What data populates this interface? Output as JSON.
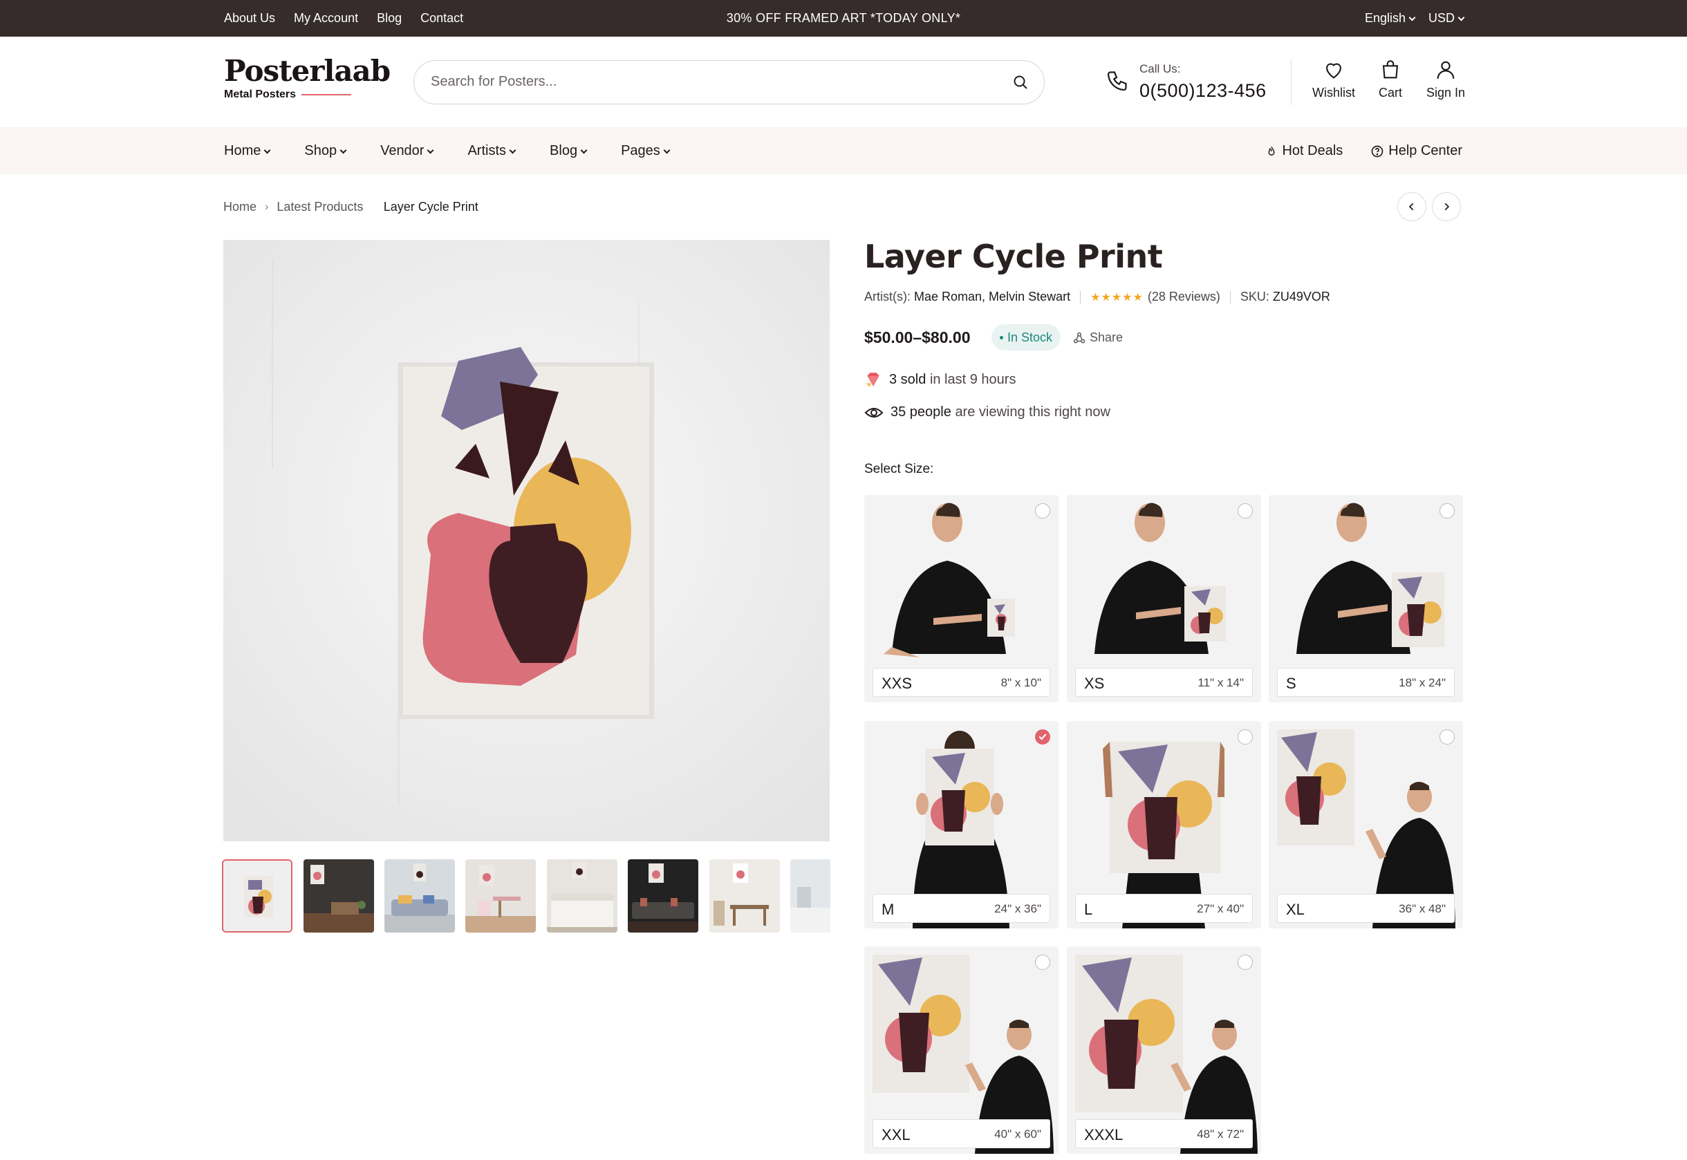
{
  "topbar": {
    "links": [
      "About Us",
      "My Account",
      "Blog",
      "Contact"
    ],
    "promo": "30% OFF FRAMED ART *TODAY ONLY*",
    "language": "English",
    "currency": "USD"
  },
  "header": {
    "logo_name": "Posterlaab",
    "logo_sub": "Metal Posters",
    "search_placeholder": "Search for Posters...",
    "call_label": "Call Us:",
    "phone": "0(500)123-456",
    "wishlist": "Wishlist",
    "cart": "Cart",
    "signin": "Sign In"
  },
  "nav": {
    "items": [
      "Home",
      "Shop",
      "Vendor",
      "Artists",
      "Blog",
      "Pages"
    ],
    "hot_deals": "Hot Deals",
    "help_center": "Help Center"
  },
  "breadcrumb": [
    "Home",
    "Latest Products",
    "Layer Cycle Print"
  ],
  "product": {
    "title": "Layer Cycle Print",
    "artists_label": "Artist(s):",
    "artists": "Mae Roman, Melvin Stewart",
    "rating": 5,
    "reviews": "(28 Reviews)",
    "sku_label": "SKU:",
    "sku": "ZU49VOR",
    "price": "$50.00–$80.00",
    "stock": "In Stock",
    "share": "Share",
    "sold_count": "3 sold",
    "sold_suffix": "in last 9 hours",
    "viewers": "35 people",
    "viewers_suffix": "are viewing this right now",
    "select_size": "Select Size:"
  },
  "sizes": [
    {
      "name": "XXS",
      "dims": "8\" x 10\"",
      "selected": false
    },
    {
      "name": "XS",
      "dims": "11\" x 14\"",
      "selected": false
    },
    {
      "name": "S",
      "dims": "18\" x 24\"",
      "selected": false
    },
    {
      "name": "M",
      "dims": "24\" x 36\"",
      "selected": true
    },
    {
      "name": "L",
      "dims": "27\" x 40\"",
      "selected": false
    },
    {
      "name": "XL",
      "dims": "36\" x 48\"",
      "selected": false
    },
    {
      "name": "XXL",
      "dims": "40\" x 60\"",
      "selected": false
    },
    {
      "name": "XXXL",
      "dims": "48\" x 72\"",
      "selected": false
    }
  ],
  "colors": {
    "topbar_bg": "#362c2c",
    "accent": "#e0646a",
    "nav_bg": "#fbf5f4",
    "stock_green": "#1a8a7c",
    "star": "#f5a623"
  }
}
